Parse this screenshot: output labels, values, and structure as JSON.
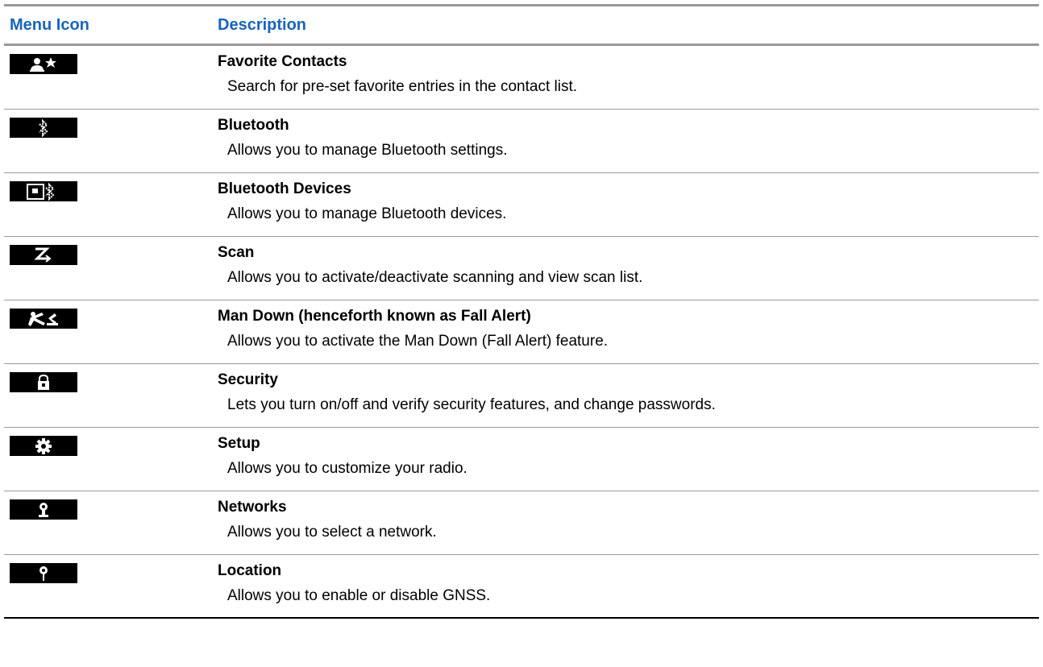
{
  "header": {
    "menu_icon_label": "Menu Icon",
    "description_label": "Description",
    "header_color": "#1565c0"
  },
  "rows": [
    {
      "icon": "favorite-contacts-icon",
      "title": "Favorite Contacts",
      "description": "Search for pre-set favorite entries in the contact list."
    },
    {
      "icon": "bluetooth-icon",
      "title": "Bluetooth",
      "description": "Allows you to manage Bluetooth settings."
    },
    {
      "icon": "bluetooth-devices-icon",
      "title": "Bluetooth Devices",
      "description": "Allows you to manage Bluetooth devices."
    },
    {
      "icon": "scan-icon",
      "title": "Scan",
      "description": "Allows you to activate/deactivate scanning and view scan list."
    },
    {
      "icon": "man-down-icon",
      "title": "Man Down (henceforth known as Fall Alert)",
      "description": "Allows you to activate the Man Down (Fall Alert) feature."
    },
    {
      "icon": "security-lock-icon",
      "title": "Security",
      "description": "Lets you turn on/off and verify security features, and change passwords."
    },
    {
      "icon": "setup-gear-icon",
      "title": "Setup",
      "description": "Allows you to customize your radio."
    },
    {
      "icon": "networks-icon",
      "title": "Networks",
      "description": "Allows you to select a network."
    },
    {
      "icon": "location-pin-icon",
      "title": "Location",
      "description": "Allows you to enable or disable GNSS."
    }
  ]
}
